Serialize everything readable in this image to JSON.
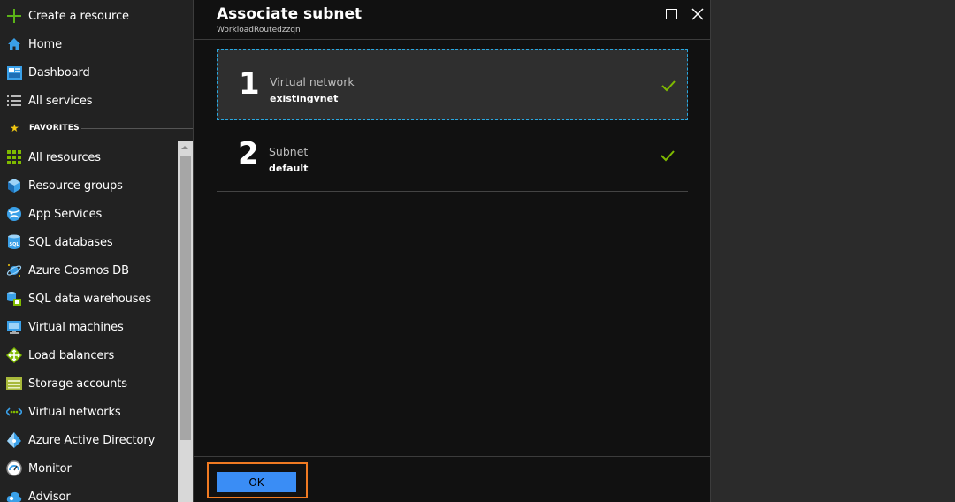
{
  "sidebar": {
    "create_resource": {
      "label": "Create a resource",
      "icon": "plus-icon"
    },
    "top_items": [
      {
        "label": "Home",
        "icon": "home-icon"
      },
      {
        "label": "Dashboard",
        "icon": "dashboard-icon"
      },
      {
        "label": "All services",
        "icon": "list-icon"
      }
    ],
    "favorites_label": "FAVORITES",
    "favorites": [
      {
        "label": "All resources",
        "icon": "grid-icon"
      },
      {
        "label": "Resource groups",
        "icon": "cube-icon"
      },
      {
        "label": "App Services",
        "icon": "globe-icon"
      },
      {
        "label": "SQL databases",
        "icon": "sql-icon"
      },
      {
        "label": "Azure Cosmos DB",
        "icon": "planet-icon"
      },
      {
        "label": "SQL data warehouses",
        "icon": "warehouse-icon"
      },
      {
        "label": "Virtual machines",
        "icon": "monitor-icon"
      },
      {
        "label": "Load balancers",
        "icon": "diamond-arrows-icon"
      },
      {
        "label": "Storage accounts",
        "icon": "storage-icon"
      },
      {
        "label": "Virtual networks",
        "icon": "vnet-icon"
      },
      {
        "label": "Azure Active Directory",
        "icon": "aad-icon"
      },
      {
        "label": "Monitor",
        "icon": "gauge-icon"
      },
      {
        "label": "Advisor",
        "icon": "cloud-icon"
      }
    ]
  },
  "blade": {
    "title": "Associate subnet",
    "subtitle": "WorkloadRoutedzzqn",
    "steps": [
      {
        "number": "1",
        "title": "Virtual network",
        "value": "existingvnet",
        "status": "complete"
      },
      {
        "number": "2",
        "title": "Subnet",
        "value": "default",
        "status": "complete"
      }
    ],
    "ok_label": "OK"
  },
  "colors": {
    "accent": "#3a8df5",
    "highlight": "#f07a22",
    "check": "#7fba00",
    "active_border": "#29a8e0"
  }
}
